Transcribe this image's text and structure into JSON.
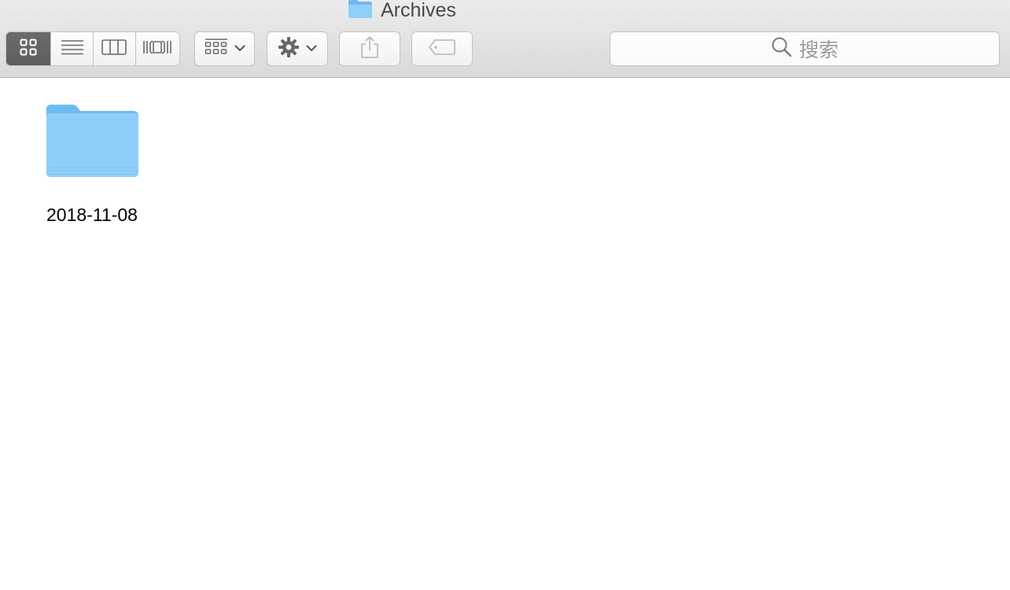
{
  "window": {
    "title": "Archives"
  },
  "toolbar": {
    "view_modes": [
      {
        "name": "icon",
        "icon": "icon-view-icon",
        "active": true
      },
      {
        "name": "list",
        "icon": "list-view-icon",
        "active": false
      },
      {
        "name": "columns",
        "icon": "column-view-icon",
        "active": false
      },
      {
        "name": "gallery",
        "icon": "coverflow-view-icon",
        "active": false
      }
    ],
    "group_button": {
      "icon": "group-by-icon"
    },
    "action_button": {
      "icon": "gear-icon"
    },
    "share_button": {
      "icon": "share-icon"
    },
    "tag_button": {
      "icon": "tag-icon"
    },
    "search": {
      "placeholder": "搜索",
      "icon": "search-icon"
    }
  },
  "colors": {
    "folder_blue": "#7cc4f4",
    "toolbar_bg": "#e3e3e3",
    "active_segment": "#646464"
  },
  "files": [
    {
      "name": "2018-11-08",
      "kind": "folder",
      "icon": "folder-icon"
    }
  ]
}
